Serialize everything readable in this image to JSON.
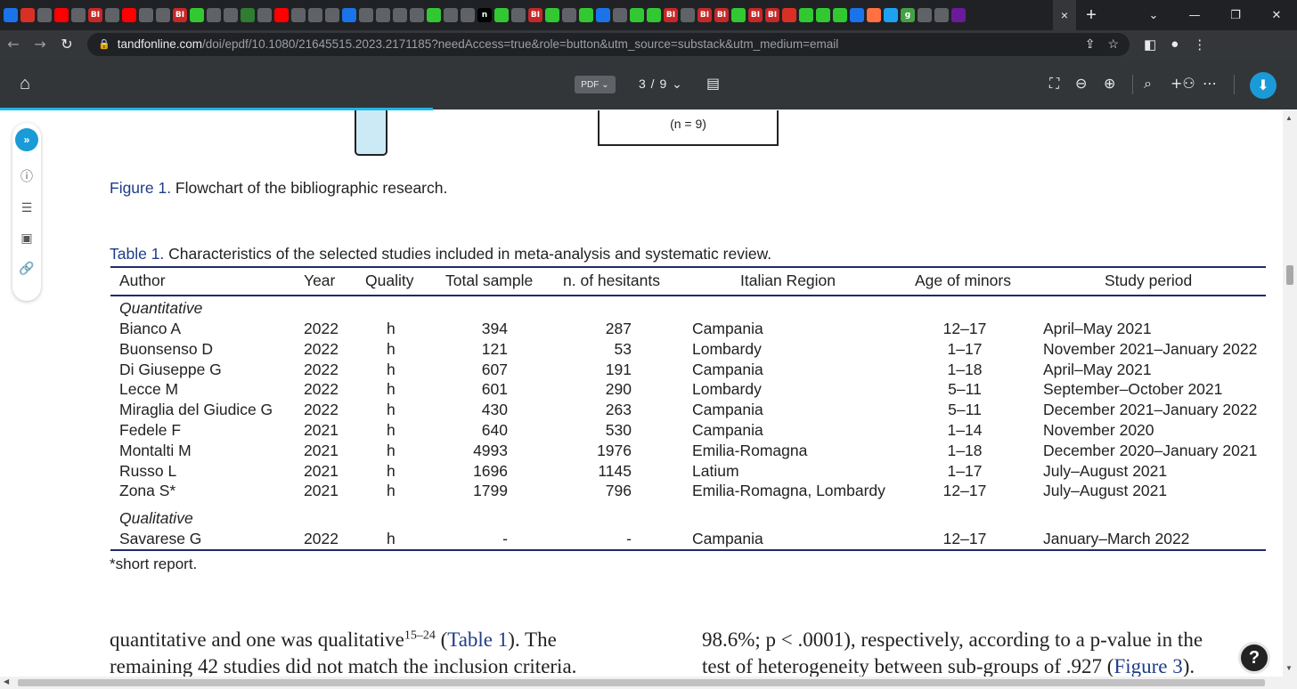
{
  "browser": {
    "tab_icons": [
      {
        "label": "",
        "color": "#1a73e8"
      },
      {
        "label": "",
        "color": "#d93025"
      },
      {
        "label": "",
        "color": "#5f6368"
      },
      {
        "label": "",
        "color": "#ff0000"
      },
      {
        "label": "",
        "color": "#5f6368"
      },
      {
        "label": "BI",
        "color": "#c62828"
      },
      {
        "label": "",
        "color": "#5f6368"
      },
      {
        "label": "",
        "color": "#ff0000"
      },
      {
        "label": "",
        "color": "#5f6368"
      },
      {
        "label": "",
        "color": "#5f6368"
      },
      {
        "label": "BI",
        "color": "#c62828"
      },
      {
        "label": "",
        "color": "#32c832"
      },
      {
        "label": "",
        "color": "#5f6368"
      },
      {
        "label": "",
        "color": "#5f6368"
      },
      {
        "label": "",
        "color": "#2e7d32"
      },
      {
        "label": "",
        "color": "#5f6368"
      },
      {
        "label": "",
        "color": "#ff0000"
      },
      {
        "label": "",
        "color": "#5f6368"
      },
      {
        "label": "",
        "color": "#5f6368"
      },
      {
        "label": "",
        "color": "#5f6368"
      },
      {
        "label": "",
        "color": "#1a73e8"
      },
      {
        "label": "",
        "color": "#5f6368"
      },
      {
        "label": "",
        "color": "#5f6368"
      },
      {
        "label": "",
        "color": "#5f6368"
      },
      {
        "label": "",
        "color": "#5f6368"
      },
      {
        "label": "",
        "color": "#32c832"
      },
      {
        "label": "",
        "color": "#5f6368"
      },
      {
        "label": "",
        "color": "#5f6368"
      },
      {
        "label": "n",
        "color": "#000000"
      },
      {
        "label": "",
        "color": "#32c832"
      },
      {
        "label": "",
        "color": "#5f6368"
      },
      {
        "label": "BI",
        "color": "#c62828"
      },
      {
        "label": "",
        "color": "#32c832"
      },
      {
        "label": "",
        "color": "#5f6368"
      },
      {
        "label": "",
        "color": "#32c832"
      },
      {
        "label": "",
        "color": "#1a73e8"
      },
      {
        "label": "",
        "color": "#5f6368"
      },
      {
        "label": "",
        "color": "#32c832"
      },
      {
        "label": "",
        "color": "#32c832"
      },
      {
        "label": "BI",
        "color": "#c62828"
      },
      {
        "label": "",
        "color": "#5f6368"
      },
      {
        "label": "BI",
        "color": "#c62828"
      },
      {
        "label": "BI",
        "color": "#c62828"
      },
      {
        "label": "",
        "color": "#32c832"
      },
      {
        "label": "BI",
        "color": "#c62828"
      },
      {
        "label": "BI",
        "color": "#c62828"
      },
      {
        "label": "",
        "color": "#d93025"
      },
      {
        "label": "",
        "color": "#32c832"
      },
      {
        "label": "",
        "color": "#32c832"
      },
      {
        "label": "",
        "color": "#32c832"
      },
      {
        "label": "",
        "color": "#1a73e8"
      },
      {
        "label": "",
        "color": "#ff7043"
      },
      {
        "label": "",
        "color": "#1da1f2"
      },
      {
        "label": "g",
        "color": "#43a047"
      },
      {
        "label": "",
        "color": "#5f6368"
      },
      {
        "label": "",
        "color": "#5f6368"
      },
      {
        "label": "",
        "color": "#6a1b9a"
      }
    ],
    "active_tab_close": "×",
    "new_tab": "+",
    "window_controls": [
      "⌄",
      "—",
      "❐",
      "✕"
    ],
    "url_host": "tandfonline.com",
    "url_path": "/doi/epdf/10.1080/21645515.2023.2171185?needAccess=true&role=button&utm_source=substack&utm_medium=email"
  },
  "pdf_toolbar": {
    "badge": "PDF",
    "page_indicator": "3 / 9"
  },
  "flowchart_fragment": {
    "box_text": "(n = 9)"
  },
  "figure_caption": {
    "label": "Figure 1.",
    "text": " Flowchart of the bibliographic research."
  },
  "table": {
    "caption_label": "Table 1.",
    "caption_text": " Characteristics of the selected studies included in meta-analysis and systematic review.",
    "headers": [
      "Author",
      "Year",
      "Quality",
      "Total sample",
      "n. of hesitants",
      "Italian Region",
      "Age of minors",
      "Study period"
    ],
    "sections": [
      {
        "name": "Quantitative",
        "rows": [
          [
            "Bianco A",
            "2022",
            "h",
            "394",
            "287",
            "Campania",
            "12–17",
            "April–May 2021"
          ],
          [
            "Buonsenso D",
            "2022",
            "h",
            "121",
            "53",
            "Lombardy",
            "1–17",
            "November 2021–January 2022"
          ],
          [
            "Di Giuseppe G",
            "2022",
            "h",
            "607",
            "191",
            "Campania",
            "1–18",
            "April–May 2021"
          ],
          [
            "Lecce M",
            "2022",
            "h",
            "601",
            "290",
            "Lombardy",
            "5–11",
            "September–October 2021"
          ],
          [
            "Miraglia del Giudice G",
            "2022",
            "h",
            "430",
            "263",
            "Campania",
            "5–11",
            "December 2021–January 2022"
          ],
          [
            "Fedele F",
            "2021",
            "h",
            "640",
            "530",
            "Campania",
            "1–14",
            "November 2020"
          ],
          [
            "Montalti M",
            "2021",
            "h",
            "4993",
            "1976",
            "Emilia-Romagna",
            "1–18",
            "December 2020–January 2021"
          ],
          [
            "Russo L",
            "2021",
            "h",
            "1696",
            "1145",
            "Latium",
            "1–17",
            "July–August 2021"
          ],
          [
            "Zona S*",
            "2021",
            "h",
            "1799",
            "796",
            "Emilia-Romagna, Lombardy",
            "12–17",
            "July–August 2021"
          ]
        ]
      },
      {
        "name": "Qualitative",
        "rows": [
          [
            "Savarese G",
            "2022",
            "h",
            "-",
            "-",
            "Campania",
            "12–17",
            "January–March 2022"
          ]
        ]
      }
    ],
    "footnote": "*short report."
  },
  "body": {
    "left_line1_a": "quantitative and one was qualitative",
    "left_line1_sup": "15–24",
    "left_line1_ref_open": " (",
    "left_line1_ref": "Table 1",
    "left_line1_end": "). The",
    "left_line2": "remaining 42 studies did not match the inclusion criteria.",
    "right_line1": "98.6%; p < .0001), respectively, according to a p-value in the",
    "right_line2_a": "test of heterogeneity between sub-groups of .927 (",
    "right_line2_ref": "Figure 3",
    "right_line2_end": ")."
  },
  "help_label": "?"
}
